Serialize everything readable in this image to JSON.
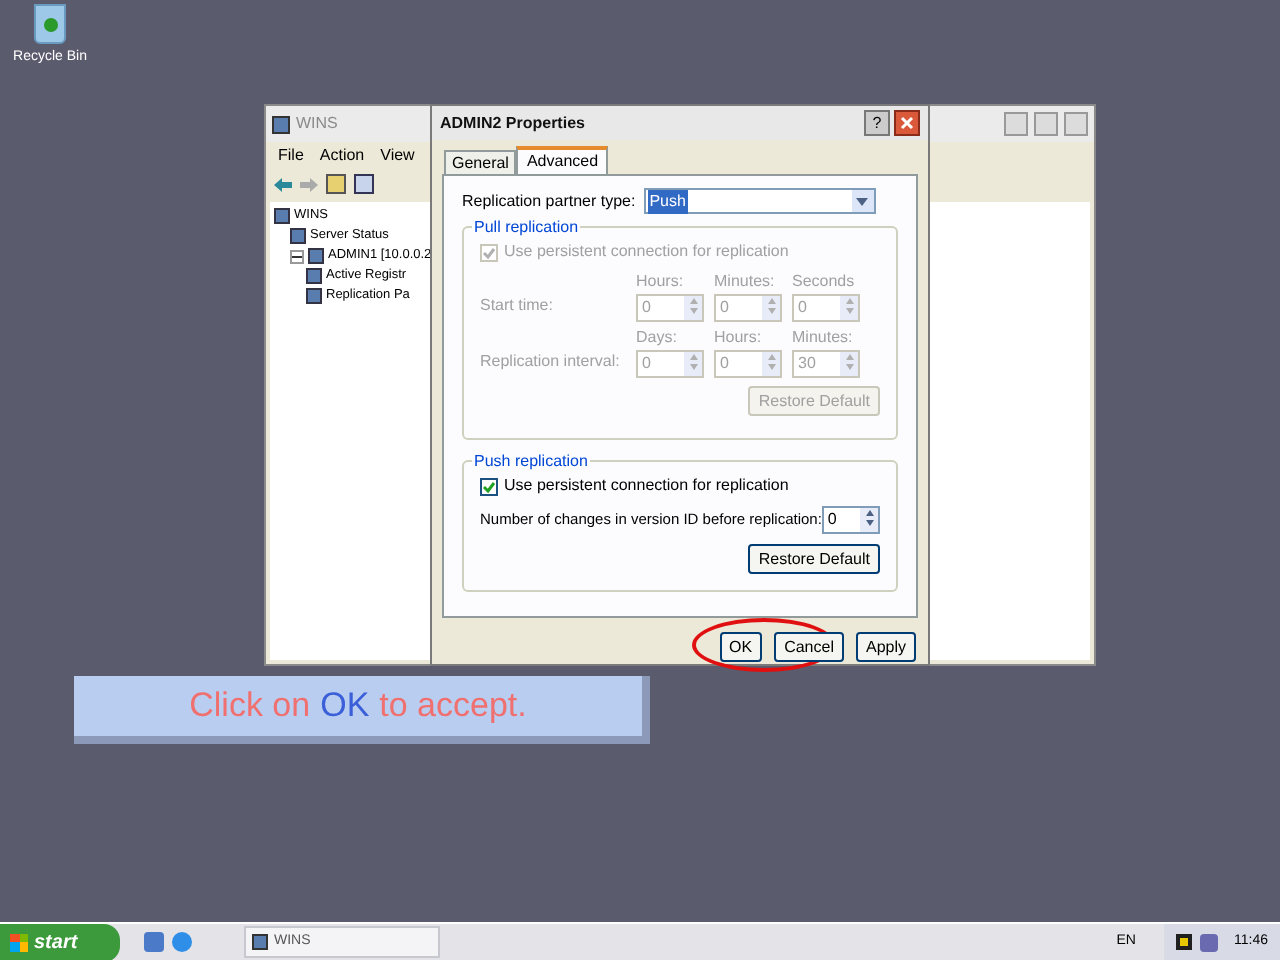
{
  "desktop_icons": [
    {
      "label": "Recycle Bin"
    }
  ],
  "wins_window": {
    "title": "WINS",
    "menu": [
      "File",
      "Action",
      "View"
    ],
    "tree": [
      {
        "label": "WINS",
        "children": [
          {
            "label": "Server Status"
          },
          {
            "label": "ADMIN1 [10.0.0.2",
            "expanded": true,
            "children": [
              {
                "label": "Active Registr"
              },
              {
                "label": "Replication Pa"
              }
            ]
          }
        ]
      }
    ]
  },
  "dialog": {
    "title": "ADMIN2 Properties",
    "help": "?",
    "tabs": [
      {
        "label": "General",
        "selected": false
      },
      {
        "label": "Advanced",
        "selected": true
      }
    ],
    "partner_type": {
      "label": "Replication partner type:",
      "value": "Push"
    },
    "pull": {
      "title": "Pull replication",
      "disabled": true,
      "checkbox": {
        "label": "Use persistent connection for replication",
        "checked": true
      },
      "rows": [
        {
          "label": "Start time:",
          "fields": [
            {
              "header": "Hours:",
              "value": "0"
            },
            {
              "header": "Minutes:",
              "value": "0"
            },
            {
              "header": "Seconds",
              "value": "0"
            }
          ]
        },
        {
          "label": "Replication interval:",
          "fields": [
            {
              "header": "Days:",
              "value": "0"
            },
            {
              "header": "Hours:",
              "value": "0"
            },
            {
              "header": "Minutes:",
              "value": "30"
            }
          ]
        }
      ],
      "restore": "Restore Default"
    },
    "push": {
      "title": "Push replication",
      "disabled": false,
      "checkbox": {
        "label": "Use persistent connection for replication",
        "checked": true
      },
      "changes_label": "Number of changes in version ID before replication:",
      "changes_value": "0",
      "restore": "Restore Default"
    },
    "buttons": [
      {
        "label": "OK",
        "highlighted": true
      },
      {
        "label": "Cancel",
        "highlighted": false
      },
      {
        "label": "Apply",
        "highlighted": false
      }
    ]
  },
  "callout": {
    "parts": [
      {
        "text": "Click on",
        "kind": "plain"
      },
      {
        "text": "OK",
        "kind": "key"
      },
      {
        "text": "to accept.",
        "kind": "plain"
      }
    ]
  },
  "taskbar": {
    "start": "start",
    "tasks": [
      {
        "label": "WINS"
      }
    ],
    "language": "EN",
    "clock": "11:46"
  }
}
